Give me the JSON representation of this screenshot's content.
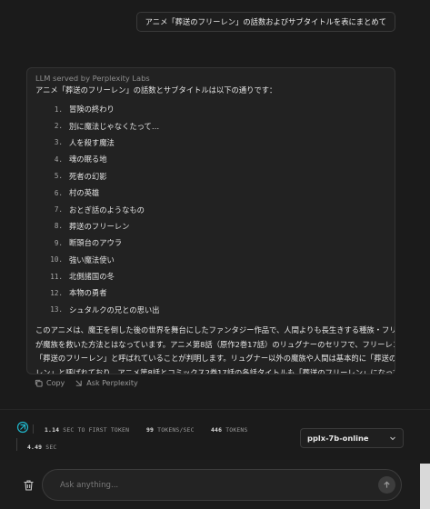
{
  "user_message": "アニメ「葬送のフリーレン」の話数およびサブタイトルを表にまとめて",
  "answer": {
    "served_by": "LLM served by Perplexity Labs",
    "intro": "アニメ「葬送のフリーレン」の話数とサブタイトルは以下の通りです：",
    "episodes": [
      {
        "num": "1.",
        "title": "冒険の終わり"
      },
      {
        "num": "2.",
        "title": "別に魔法じゃなくたって…"
      },
      {
        "num": "3.",
        "title": "人を殺す魔法"
      },
      {
        "num": "4.",
        "title": "魂の眠る地"
      },
      {
        "num": "5.",
        "title": "死者の幻影"
      },
      {
        "num": "6.",
        "title": "村の英雄"
      },
      {
        "num": "7.",
        "title": "おとぎ話のようなもの"
      },
      {
        "num": "8.",
        "title": "葬送のフリーレン"
      },
      {
        "num": "9.",
        "title": "断頭台のアウラ"
      },
      {
        "num": "10.",
        "title": "強い魔法使い"
      },
      {
        "num": "11.",
        "title": "北側諸国の冬"
      },
      {
        "num": "12.",
        "title": "本物の勇者"
      },
      {
        "num": "13.",
        "title": "シュタルクの兄との思い出"
      }
    ],
    "summary_lines": [
      "このアニメは、魔王を倒した後の世界を舞台にしたファンタジー作品で、人間よりも長生きする種族・フリーレン",
      "が魔族を救いた方法とはなっています。アニメ第8話（原作2巻17話）のリュグナーのセリフで、フリーレンが",
      "「葬送のフリーレン」と呼ばれていることが判明します。リュグナー以外の魔族や人間は基本的に「葬送のフリー",
      "レン」と呼ばれており、アニメ第8話とコミックス2巻17話の各話タイトルも「葬送のフリーレン」になっています。"
    ]
  },
  "actions": {
    "copy": "Copy",
    "ask": "Ask Perplexity"
  },
  "stats": {
    "first_token_value": "1.14",
    "first_token_label": "SEC TO FIRST TOKEN",
    "tps_value": "99",
    "tps_label": "TOKENS/SEC",
    "tokens_value": "446",
    "tokens_label": "TOKENS",
    "total_value": "4.49",
    "total_label": "SEC"
  },
  "model_select": {
    "selected": "pplx-7b-online"
  },
  "composer": {
    "placeholder": "Ask anything..."
  },
  "colors": {
    "background": "#1b1b1b",
    "card": "#222222",
    "accent": "#20b8cd"
  },
  "icons": [
    "copy-icon",
    "ask-perplexity-icon",
    "perplexity-logo-icon",
    "chevron-down-icon",
    "trash-icon",
    "arrow-up-icon"
  ]
}
